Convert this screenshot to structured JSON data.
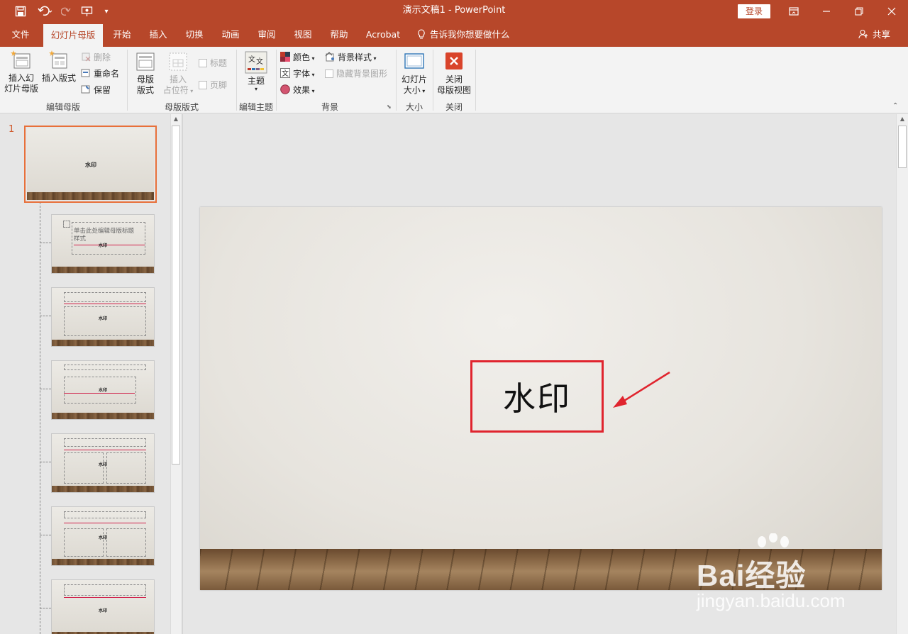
{
  "window": {
    "title": "演示文稿1  -  PowerPoint",
    "login_label": "登录"
  },
  "tabs": [
    {
      "label": "文件"
    },
    {
      "label": "幻灯片母版"
    },
    {
      "label": "开始"
    },
    {
      "label": "插入"
    },
    {
      "label": "切换"
    },
    {
      "label": "动画"
    },
    {
      "label": "审阅"
    },
    {
      "label": "视图"
    },
    {
      "label": "帮助"
    },
    {
      "label": "Acrobat"
    }
  ],
  "tell_me": "告诉我你想要做什么",
  "share": "共享",
  "ribbon": {
    "edit_master": {
      "insert_slide_master": [
        "插入幻",
        "灯片母版"
      ],
      "insert_layout": "插入版式",
      "delete": "删除",
      "rename": "重命名",
      "preserve": "保留",
      "group_label": "编辑母版"
    },
    "master_layout": {
      "master_layout": [
        "母版",
        "版式"
      ],
      "insert_placeholder": [
        "插入",
        "占位符"
      ],
      "title": "标题",
      "footer": "页脚",
      "group_label": "母版版式"
    },
    "edit_theme": {
      "themes": "主题",
      "group_label": "编辑主题"
    },
    "background": {
      "colors": "颜色",
      "fonts": "字体",
      "effects": "效果",
      "background_styles": "背景样式",
      "hide_background_graphics": "隐藏背景图形",
      "group_label": "背景"
    },
    "size": {
      "slide_size": [
        "幻灯片",
        "大小"
      ],
      "group_label": "大小"
    },
    "close": {
      "close_master_view": [
        "关闭",
        "母版视图"
      ],
      "group_label": "关闭"
    }
  },
  "thumbnails": {
    "slide_number": "1",
    "master_text": "水印",
    "layout2_title": "单击此处编辑母版标题",
    "layout2_title_line2": "样式"
  },
  "slide": {
    "watermark_text": "水印"
  },
  "overlay": {
    "baidu_logo": "Bai经验",
    "baidu_url": "jingyan.baidu.com"
  },
  "colors": {
    "accent": "#b7472a",
    "highlight": "#e0242e"
  }
}
